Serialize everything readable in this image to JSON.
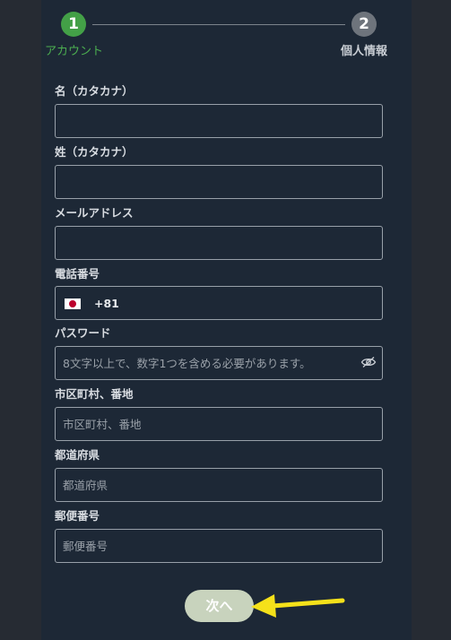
{
  "stepper": {
    "step1": {
      "number": "1",
      "label": "アカウント"
    },
    "step2": {
      "number": "2",
      "label": "個人情報"
    }
  },
  "form": {
    "first_name_kana": {
      "label": "名（カタカナ）",
      "value": "",
      "placeholder": ""
    },
    "last_name_kana": {
      "label": "姓（カタカナ）",
      "value": "",
      "placeholder": ""
    },
    "email": {
      "label": "メールアドレス",
      "value": "",
      "placeholder": ""
    },
    "phone": {
      "label": "電話番号",
      "country_flag": "japan-flag-icon",
      "dial_code": "+81",
      "value": ""
    },
    "password": {
      "label": "パスワード",
      "value": "",
      "placeholder": "8文字以上で、数字1つを含める必要があります。",
      "toggle_icon": "eye-slash-icon"
    },
    "city": {
      "label": "市区町村、番地",
      "value": "",
      "placeholder": "市区町村、番地"
    },
    "prefecture": {
      "label": "都道府県",
      "value": "",
      "placeholder": "都道府県"
    },
    "postal_code": {
      "label": "郵便番号",
      "value": "",
      "placeholder": "郵便番号"
    }
  },
  "actions": {
    "next_label": "次へ"
  },
  "colors": {
    "accent_green": "#43a047",
    "inactive_step": "#6e747c",
    "panel_bg": "#1d2836",
    "page_bg": "#262b33",
    "next_button_bg": "#c8d3bd",
    "annotation_arrow": "#f5e11a"
  }
}
